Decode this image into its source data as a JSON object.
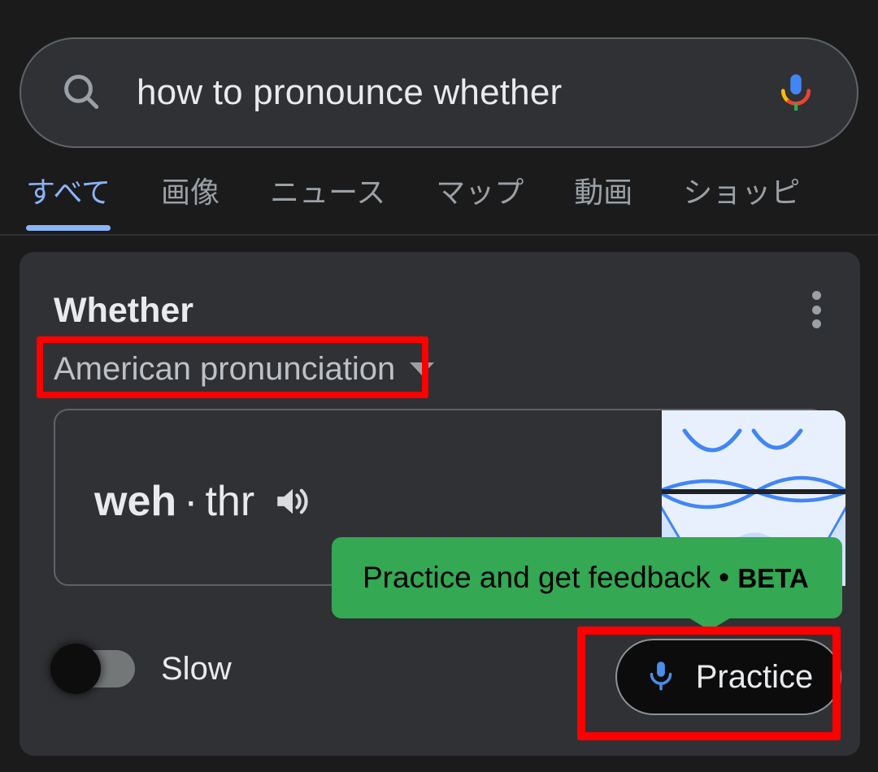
{
  "search": {
    "query": "how to pronounce whether",
    "search_icon": "search-icon",
    "mic_icon": "google-mic-icon"
  },
  "tabs": [
    {
      "label": "すべて",
      "active": true
    },
    {
      "label": "画像",
      "active": false
    },
    {
      "label": "ニュース",
      "active": false
    },
    {
      "label": "マップ",
      "active": false
    },
    {
      "label": "動画",
      "active": false
    },
    {
      "label": "ショッピ",
      "active": false
    }
  ],
  "card": {
    "title": "Whether",
    "overflow_icon": "more-vert-icon",
    "accent_blue": "#8ab4f8",
    "background": "#303134",
    "dropdown": {
      "selected": "American pronunciation",
      "caret_icon": "chevron-down-icon"
    },
    "pronunciation": {
      "stressed_syllable": "weh",
      "separator": "·",
      "rest_syllable": "thr",
      "speaker_icon": "volume-up-icon"
    },
    "mouth_image": {
      "alt": "mouth-diagram",
      "background": "#e8f0fe",
      "stroke": "#4285f4"
    },
    "slow_toggle": {
      "label": "Slow",
      "state": "off"
    },
    "practice_button": {
      "label": "Practice",
      "mic_icon": "microphone-icon",
      "mic_color": "#4a90e8"
    }
  },
  "tooltip": {
    "text": "Practice and get feedback • ",
    "badge": "BETA",
    "background": "#34a853"
  },
  "annotations": {
    "highlight_color": "#ff0000",
    "boxes": [
      "american-pronunciation-dropdown",
      "practice-button"
    ]
  }
}
